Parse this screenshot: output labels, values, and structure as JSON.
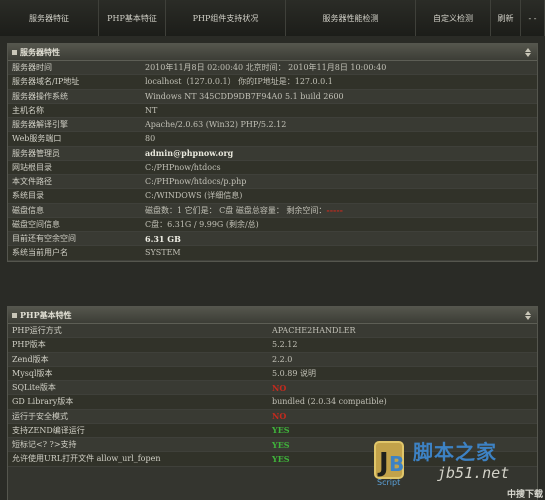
{
  "nav": {
    "items": [
      "服务器特征",
      "PHP基本特征",
      "PHP组件支持状况",
      "服务器性能检测",
      "自定义检测",
      "刷新",
      "- -"
    ]
  },
  "server_panel": {
    "title": "服务器特性",
    "rows": [
      {
        "label": "服务器时间",
        "value": "2010年11月8日  02:00:40   北京时间：    2010年11月8日   10:00:40"
      },
      {
        "label": "服务器域名/IP地址",
        "value": "localhost（127.0.0.1）  你的IP地址是：127.0.0.1"
      },
      {
        "label": "服务器操作系统",
        "value": "Windows NT 345CDD9DB7F94A0 5.1 build 2600"
      },
      {
        "label": "主机名称",
        "value": "NT"
      },
      {
        "label": "服务器解译引擎",
        "value": "Apache/2.0.63 (Win32) PHP/5.2.12"
      },
      {
        "label": "Web服务端口",
        "value": "80"
      },
      {
        "label": "服务器管理员",
        "value": "admin@phpnow.org"
      },
      {
        "label": "网站根目录",
        "value": "C:/PHPnow/htdocs"
      },
      {
        "label": "本文件路径",
        "value": "C:/PHPnow/htdocs/p.php"
      },
      {
        "label": "系统目录",
        "value": "C:/WINDOWS (详细信息)"
      },
      {
        "label": "磁盘信息",
        "value": "磁盘数：1  它们是：  C盘      磁盘总容量：     剩余空间："
      },
      {
        "label": "磁盘空间信息",
        "value": "C盘：6.31G / 9.99G     (剩余/总)"
      },
      {
        "label": "目前还有空余空间",
        "value": "6.31 GB"
      },
      {
        "label": "系统当前用户名",
        "value": "SYSTEM"
      }
    ],
    "disk_free_value": "-----"
  },
  "php_panel": {
    "title": "PHP基本特性",
    "rows": [
      {
        "label": "PHP运行方式",
        "value": "APACHE2HANDLER",
        "status": "plain"
      },
      {
        "label": "PHP版本",
        "value": "5.2.12",
        "status": "plain"
      },
      {
        "label": "Zend版本",
        "value": "2.2.0",
        "status": "plain"
      },
      {
        "label": "Mysql版本",
        "value": "5.0.89 说明",
        "status": "plain"
      },
      {
        "label": "SQLite版本",
        "value": "NO",
        "status": "red"
      },
      {
        "label": "GD Library版本",
        "value": "bundled (2.0.34 compatible)",
        "status": "plain"
      },
      {
        "label": "运行于安全模式",
        "value": "NO",
        "status": "red"
      },
      {
        "label": "支持ZEND编译运行",
        "value": "YES",
        "status": "green"
      },
      {
        "label": "短标记<? ?>支持",
        "value": "YES",
        "status": "green"
      },
      {
        "label": "允许使用URL打开文件 allow_url_fopen",
        "value": "YES",
        "status": "green"
      }
    ]
  },
  "watermark": {
    "title": "脚本之家",
    "subtitle": "jb51.net",
    "script_label": "Script",
    "corner": "中搜下载网"
  },
  "colors": {
    "background": "#2a2b26",
    "panel_header": "#4a4b43",
    "no": "#c42a1e",
    "yes": "#3fb43b",
    "brand_blue": "#3d82c4"
  }
}
